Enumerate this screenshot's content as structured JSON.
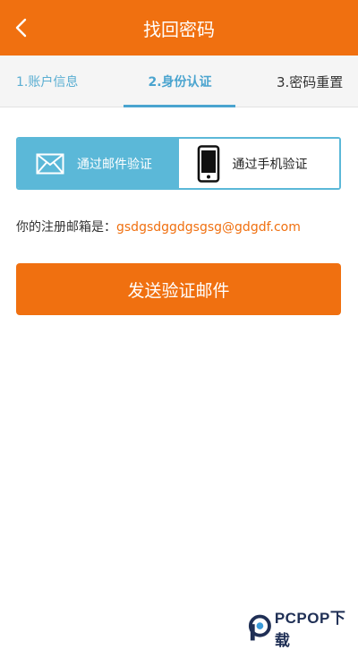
{
  "header": {
    "title": "找回密码",
    "back_icon": "chevron-left-icon"
  },
  "steps": [
    {
      "label": "1.账户信息",
      "active": false
    },
    {
      "label": "2.身份认证",
      "active": true
    },
    {
      "label": "3.密码重置",
      "active": false
    }
  ],
  "verify_options": {
    "email": {
      "label": "通过邮件验证",
      "icon": "envelope-icon",
      "selected": true
    },
    "phone": {
      "label": "通过手机验证",
      "icon": "phone-icon",
      "selected": false
    }
  },
  "email_info": {
    "prefix": "你的注册邮箱是：",
    "email": "gsdgsdggdgsgsg@gdgdf.com"
  },
  "send_button": {
    "label": "发送验证邮件"
  },
  "watermark": {
    "text": "PCPOP下载"
  },
  "colors": {
    "primary": "#f07010",
    "accent": "#5bb8d8"
  }
}
